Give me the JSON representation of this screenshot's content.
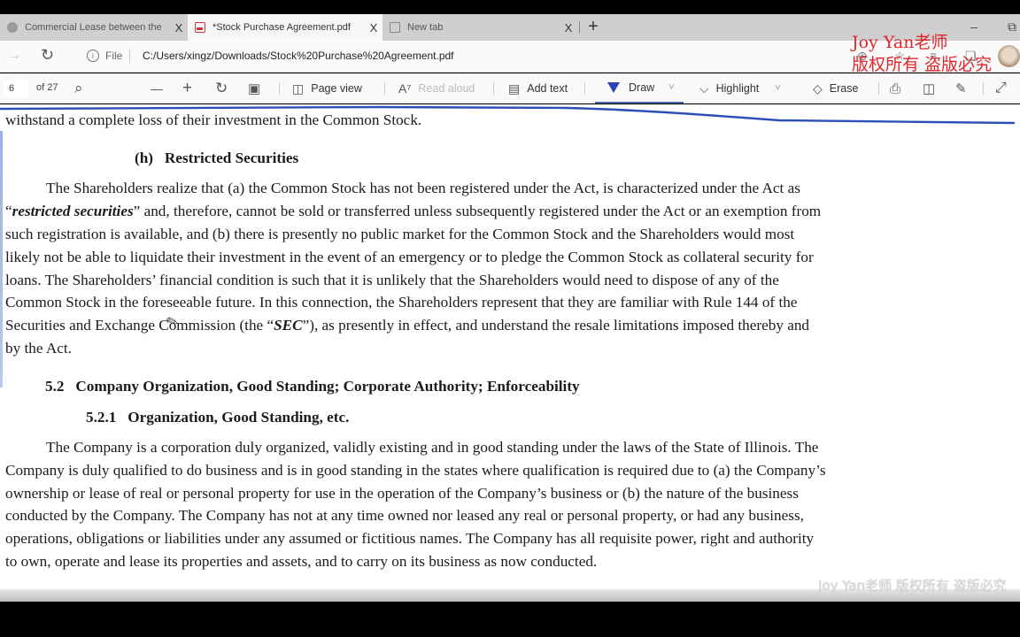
{
  "browser": {
    "tabs": [
      {
        "title": "Commercial Lease between the",
        "icon": "globe-icon",
        "close": "X"
      },
      {
        "title": "*Stock Purchase Agreement.pdf",
        "icon": "pdf-icon",
        "close": "X",
        "active": true
      },
      {
        "title": "New tab",
        "icon": "new-tab-icon",
        "close": "X"
      }
    ],
    "new_tab_symbol": "+",
    "window_controls": {
      "minimize": "–",
      "restore": "⧉"
    },
    "address": {
      "back_symbol": "→",
      "refresh_symbol": "↻",
      "info_symbol": "i",
      "scheme_label": "File",
      "url": "C:/Users/xingz/Downloads/Stock%20Purchase%20Agreement.pdf"
    },
    "right_icons": [
      "zoom-in-icon",
      "favorite-icon",
      "reading-list-icon",
      "collections-icon",
      "profile-avatar"
    ]
  },
  "pdf_toolbar": {
    "current_page": "6",
    "page_count": "of 27",
    "find_symbol": "⌕",
    "zoom_out_symbol": "—",
    "zoom_in_symbol": "+",
    "rotate_symbol": "↻",
    "fit_symbol": "▣",
    "page_view_label": "Page view",
    "read_aloud_label": "Read aloud",
    "add_text_label": "Add text",
    "draw_label": "Draw",
    "highlight_label": "Highlight",
    "erase_label": "Erase",
    "chevron": "˅"
  },
  "document": {
    "line0": "withstand a complete loss of their investment in the Common Stock.",
    "heading_h": "(h)   Restricted Securities",
    "para1": [
      "The Shareholders realize that (a) the Common Stock has not been registered under the Act, is characterized under the Act as",
      "“",
      "restricted securities",
      "” and, therefore, cannot be sold or transferred unless subsequently registered under the Act or an exemption from",
      "such registration is available, and (b) there is presently no public market for the Common Stock and the Shareholders would most",
      "likely not be able to liquidate their investment in the event of an emergency or to pledge the Common Stock as collateral security for",
      "loans. The Shareholders’ financial condition is such that it is unlikely that the Shareholders would need to dispose of any of the",
      "Common Stock in the foreseeable future. In this connection, the Shareholders represent that they are familiar with Rule 144 of the",
      "Securities and Exchange Commission (the “",
      "SEC",
      "”), as presently in effect, and understand the resale limitations imposed thereby and",
      "by the Act."
    ],
    "heading_52": "5.2   Company Organization, Good Standing; Corporate Authority; Enforceability",
    "heading_521": "5.2.1   Organization, Good Standing, etc.",
    "para2": [
      "The Company is a corporation duly organized, validly existing and in good standing under the laws of the State of Illinois. The",
      "Company is duly qualified to do business and is in good standing in the states where qualification is required due to (a) the Company’s",
      "ownership or lease of real or personal property for use in the operation of the Company’s business or (b) the nature of the business",
      "conducted by the Company. The Company has not at any time owned nor leased any real or personal property, or had any business,",
      "operations, obligations or liabilities under any assumed or fictitious names. The Company has all requisite power, right and authority",
      "to own, operate and lease its properties and assets, and to carry on its business as now conducted."
    ],
    "ink_color": "#2b4fb8"
  },
  "watermarks": {
    "top_line1": "Joy Yan老师",
    "top_line2": "版权所有 盗版必究",
    "bottom": "Joy Yan老师 版权所有 盗版必究",
    "color": "#e0262b"
  }
}
